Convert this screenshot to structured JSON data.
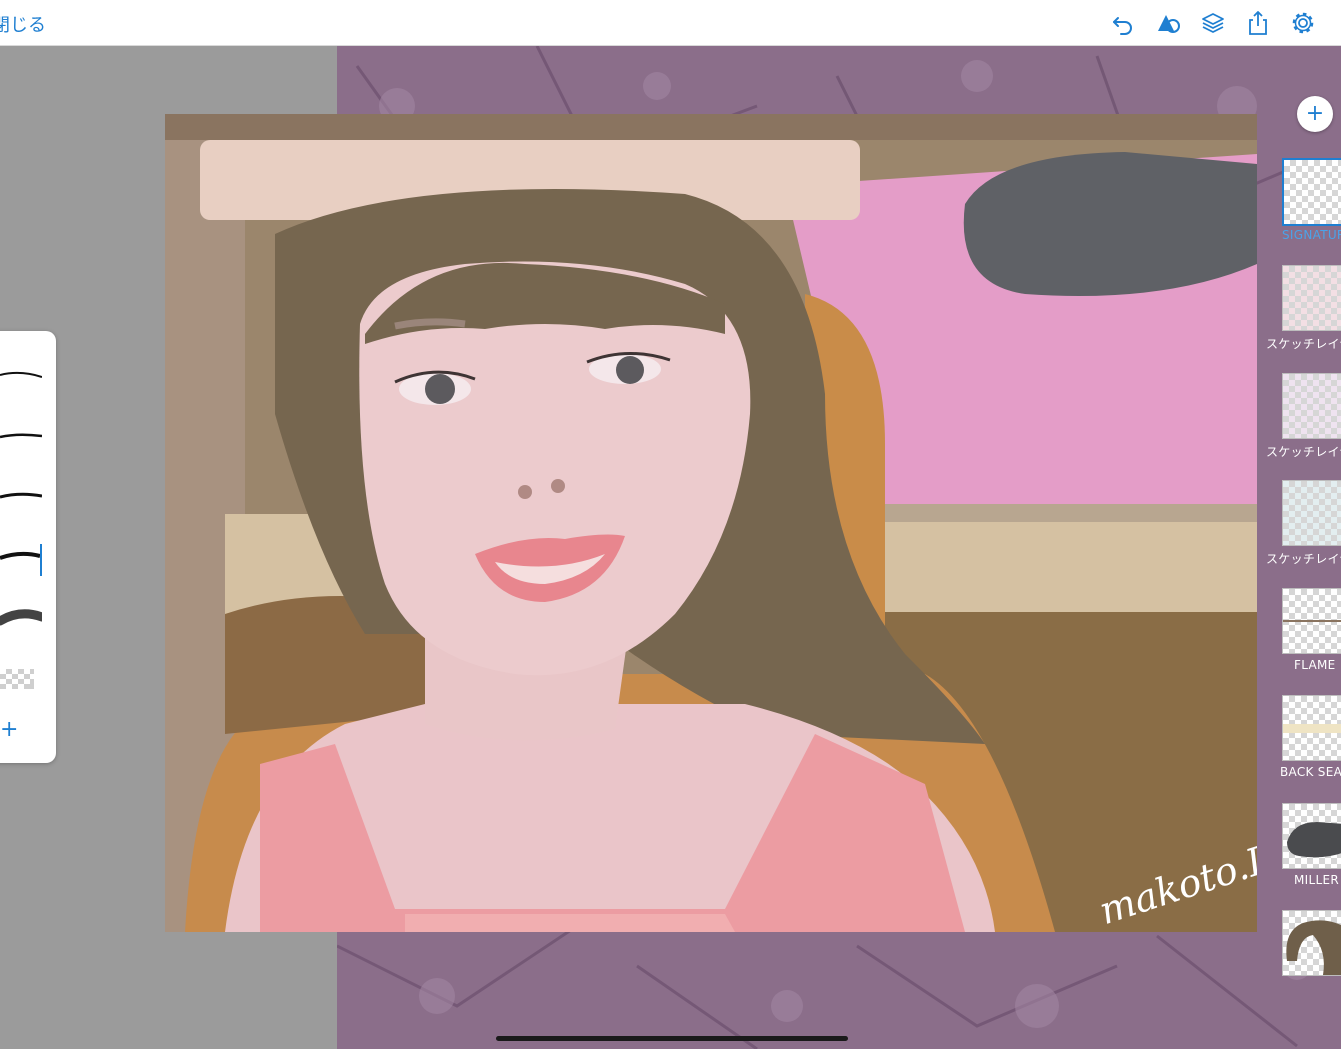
{
  "toolbar": {
    "close_label": "閉じる",
    "icons": [
      "undo-icon",
      "shapes-icon",
      "layers-icon",
      "share-icon",
      "settings-icon"
    ]
  },
  "colors": {
    "accent": "#1f7fd1",
    "workspace": "#9b9b9b"
  },
  "brush_panel": {
    "brushes": [
      "brush-1",
      "brush-2",
      "brush-3",
      "brush-4",
      "brush-5",
      "brush-6"
    ],
    "selected_index": 3,
    "add_label": "+"
  },
  "layers": {
    "add_label": "+",
    "items": [
      {
        "label": "SIGNATURE",
        "selected": true
      },
      {
        "label": "スケッチレイヤー",
        "selected": false
      },
      {
        "label": "スケッチレイヤー",
        "selected": false
      },
      {
        "label": "スケッチレイヤー",
        "selected": false
      },
      {
        "label": "FLAME",
        "selected": false
      },
      {
        "label": "BACK SEAT",
        "selected": false
      },
      {
        "label": "MILLER",
        "selected": false
      },
      {
        "label": "",
        "selected": false
      }
    ]
  },
  "artwork": {
    "signature_text": "makoto.I"
  }
}
